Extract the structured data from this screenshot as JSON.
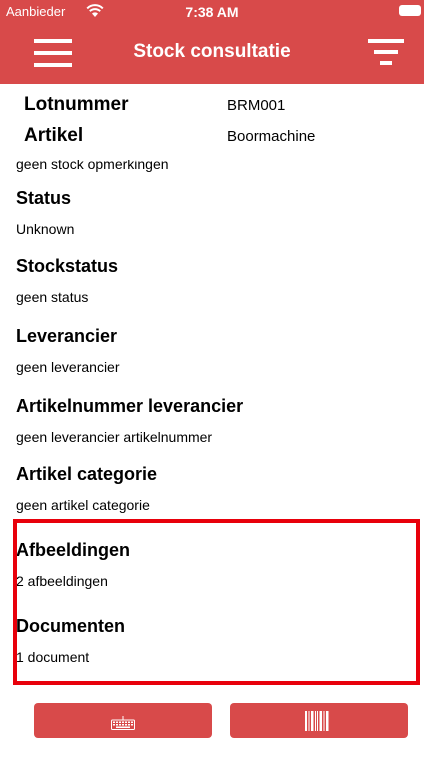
{
  "status_bar": {
    "carrier": "Aanbieder",
    "time": "7:38 AM",
    "icons": [
      "wifi-icon",
      "battery-icon"
    ]
  },
  "nav": {
    "title": "Stock consultatie",
    "left_icon": "menu-icon",
    "right_icon": "filter-icon"
  },
  "header_fields": [
    {
      "label": "Lotnummer",
      "value": "BRM001"
    },
    {
      "label": "Artikel",
      "value": "Boormachine"
    }
  ],
  "clipped_text": "geen stock opmerkingen",
  "sections": [
    {
      "title": "Status",
      "value": "Unknown"
    },
    {
      "title": "Stockstatus",
      "value": "geen status"
    },
    {
      "title": "Leverancier",
      "value": "geen leverancier"
    },
    {
      "title": "Artikelnummer leverancier",
      "value": "geen leverancier artikelnummer"
    },
    {
      "title": "Artikel categorie",
      "value": "geen artikel categorie"
    },
    {
      "title": "Afbeeldingen",
      "value": "2 afbeeldingen"
    },
    {
      "title": "Documenten",
      "value": "1 document"
    }
  ],
  "bottom_buttons": [
    {
      "icon": "keyboard-icon"
    },
    {
      "icon": "barcode-icon"
    }
  ],
  "colors": {
    "brand": "#d84a4a",
    "highlight": "#e8000b"
  }
}
